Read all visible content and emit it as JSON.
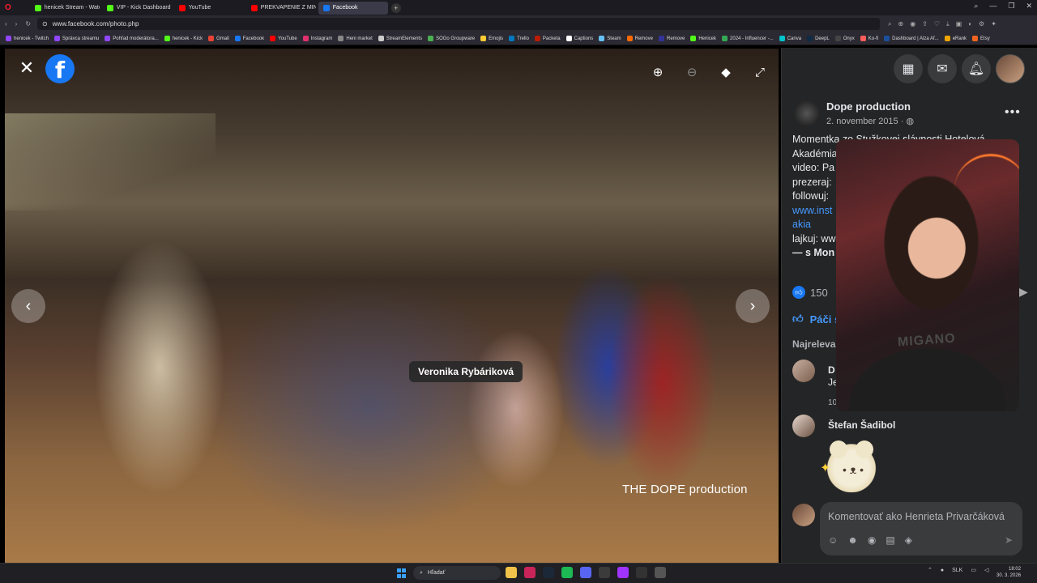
{
  "browser": {
    "tabs": [
      {
        "label": "henicek Stream - Watch L",
        "color": "#53fc18",
        "active": false
      },
      {
        "label": "VIP - Kick Dashboard",
        "color": "#53fc18",
        "active": false
      },
      {
        "label": "YouTube",
        "color": "#ff0000",
        "active": false
      },
      {
        "label": "PREKVAPENIE Z MINULOS",
        "color": "#ff0000",
        "active": false
      },
      {
        "label": "Facebook",
        "color": "#1877f2",
        "active": true
      }
    ],
    "url": "www.facebook.com/photo.php",
    "bookmarks": [
      {
        "label": "henicek - Twitch",
        "color": "#9146ff"
      },
      {
        "label": "Správca streamu",
        "color": "#9146ff"
      },
      {
        "label": "Pohľad moderátora...",
        "color": "#9146ff"
      },
      {
        "label": "henicek - Kick",
        "color": "#53fc18"
      },
      {
        "label": "Gmail",
        "color": "#ea4335"
      },
      {
        "label": "Facebook",
        "color": "#1877f2"
      },
      {
        "label": "YouTube",
        "color": "#ff0000"
      },
      {
        "label": "Instagram",
        "color": "#e1306c"
      },
      {
        "label": "Heni market",
        "color": "#888888"
      },
      {
        "label": "StreamElements",
        "color": "#cccccc"
      },
      {
        "label": "SOGo Groupware",
        "color": "#4caf50"
      },
      {
        "label": "Emojis",
        "color": "#ffcc33"
      },
      {
        "label": "Trello",
        "color": "#0079bf"
      },
      {
        "label": "Packeta",
        "color": "#ba1b02"
      },
      {
        "label": "Captions",
        "color": "#ffffff"
      },
      {
        "label": "Steam",
        "color": "#66c0f4"
      },
      {
        "label": "Remove",
        "color": "#ff6a00"
      },
      {
        "label": "Remove",
        "color": "#333399"
      },
      {
        "label": "Henicek",
        "color": "#53fc18"
      },
      {
        "label": "2024 - Influencer -...",
        "color": "#34a853"
      },
      {
        "label": "Canva",
        "color": "#00c4cc"
      },
      {
        "label": "DeepL",
        "color": "#0f2b46"
      },
      {
        "label": "Onyx",
        "color": "#444444"
      },
      {
        "label": "Ko-fi",
        "color": "#ff5e5b"
      },
      {
        "label": "Dashboard | Alza Af...",
        "color": "#1a4f9c"
      },
      {
        "label": "eRank",
        "color": "#f0a500"
      },
      {
        "label": "Etsy",
        "color": "#f1641e"
      }
    ]
  },
  "viewer": {
    "tag_name": "Veronika Rybáriková",
    "watermark": "THE DOPE production"
  },
  "post": {
    "page_name": "Dope production",
    "date": "2. november 2015 ·",
    "caption_lines": [
      {
        "text": "Momentka zo Stužkovej slávnosti Hotelová",
        "style": "normal"
      },
      {
        "text": "Akadémia",
        "style": "normal"
      },
      {
        "text": "video: Pa",
        "style": "normal"
      },
      {
        "text": "prezeraj:",
        "style": "normal"
      },
      {
        "text": "followuj:",
        "style": "normal"
      },
      {
        "text": "www.inst",
        "style": "link"
      },
      {
        "text": "akia",
        "style": "link"
      },
      {
        "text": "lajkuj: ww",
        "style": "normal"
      },
      {
        "text": "— s Mon",
        "style": "strong"
      }
    ],
    "reaction_count": "150",
    "like_label": "Páči s",
    "sort_label": "Najreleva",
    "comments": {
      "c1_name": "D",
      "c1_text": "Je",
      "c1_meta": "10",
      "c2_name": "Štefan Šadibol"
    },
    "composer_placeholder": "Komentovať ako Henrieta Privarčáková"
  },
  "webcam": {
    "shirt_text": "MIGANO"
  },
  "taskbar": {
    "search_label": "Hľadať",
    "lang": "SLK",
    "time": "18:02",
    "date": "30. 3. 2026",
    "apps": [
      {
        "name": "file-explorer-icon",
        "color": "#f0c24a"
      },
      {
        "name": "opera-gx-icon",
        "color": "#c8245a"
      },
      {
        "name": "steam-icon",
        "color": "#1b2838"
      },
      {
        "name": "spotify-icon",
        "color": "#1db954"
      },
      {
        "name": "discord-icon",
        "color": "#5865f2"
      },
      {
        "name": "xbox-icon",
        "color": "#3b3b3b"
      },
      {
        "name": "messenger-icon",
        "color": "#a033ff"
      },
      {
        "name": "obs-icon",
        "color": "#333333"
      },
      {
        "name": "media-icon",
        "color": "#555555"
      }
    ]
  }
}
